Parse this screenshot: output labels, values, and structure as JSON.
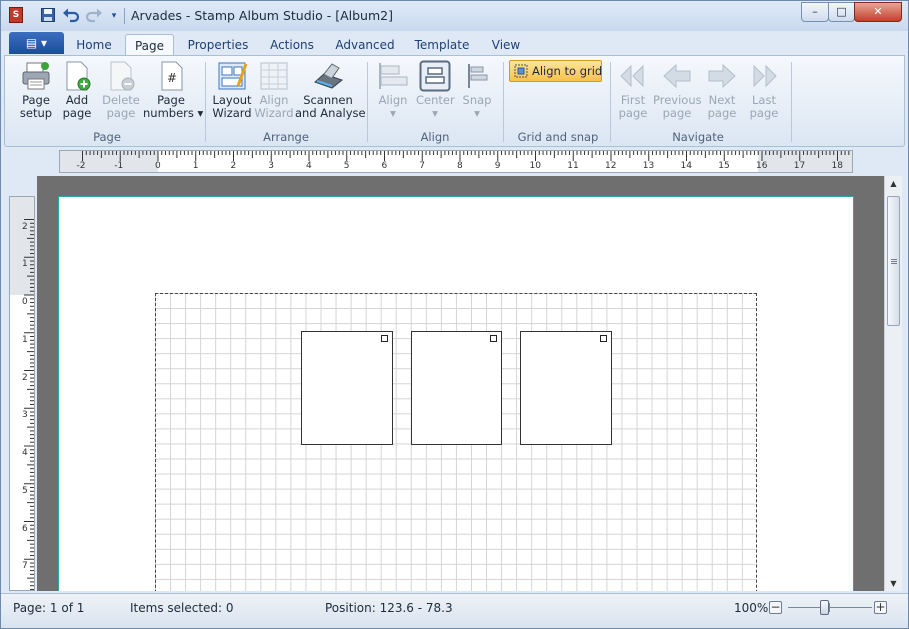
{
  "window": {
    "title": "Arvades - Stamp Album Studio - [Album2]",
    "app_icon_letter": "S",
    "controls": {
      "minimize": "–",
      "maximize": "□",
      "close": "✕"
    }
  },
  "quick_access": {
    "save_icon": "save-icon",
    "undo_icon": "undo-icon",
    "redo_icon": "redo-icon",
    "customize_icon": "chevron-down-icon"
  },
  "ribbon_tabs": {
    "file_tab": "▤ ▾",
    "tabs": [
      "Home",
      "Page",
      "Properties",
      "Actions",
      "Advanced",
      "Template",
      "View"
    ],
    "active": "Page"
  },
  "ribbon": {
    "groups": {
      "page": {
        "label": "Page",
        "buttons": [
          {
            "label": "Page\nsetup",
            "icon": "printer-icon",
            "enabled": true
          },
          {
            "label": "Add\npage",
            "icon": "add-page-icon",
            "enabled": true
          },
          {
            "label": "Delete\npage",
            "icon": "delete-page-icon",
            "enabled": false
          },
          {
            "label": "Page\nnumbers ▾",
            "icon": "page-numbers-icon",
            "enabled": true
          }
        ]
      },
      "arrange": {
        "label": "Arrange",
        "buttons": [
          {
            "label": "Layout\nWizard",
            "icon": "layout-wizard-icon",
            "enabled": true
          },
          {
            "label": "Align\nWizard",
            "icon": "align-wizard-icon",
            "enabled": false
          },
          {
            "label": "Scannen\nand Analyse",
            "icon": "scanner-icon",
            "enabled": true
          }
        ]
      },
      "align": {
        "label": "Align",
        "buttons": [
          {
            "label": "Align\n▾",
            "icon": "align-icon",
            "enabled": false
          },
          {
            "label": "Center\n▾",
            "icon": "center-icon",
            "enabled": false
          },
          {
            "label": "Snap\n▾",
            "icon": "snap-icon",
            "enabled": false
          }
        ]
      },
      "grid_and_snap": {
        "label": "Grid and snap",
        "align_to_grid": "Align to grid"
      },
      "navigate": {
        "label": "Navigate",
        "buttons": [
          {
            "label": "First\npage",
            "icon": "first-page-icon",
            "enabled": false
          },
          {
            "label": "Previous\npage",
            "icon": "previous-page-icon",
            "enabled": false
          },
          {
            "label": "Next\npage",
            "icon": "next-page-icon",
            "enabled": false
          },
          {
            "label": "Last\npage",
            "icon": "last-page-icon",
            "enabled": false
          }
        ]
      }
    }
  },
  "rulers": {
    "horizontal_labels": [
      "-2",
      "-1",
      "0",
      "1",
      "2",
      "3",
      "4",
      "5",
      "6",
      "7",
      "8",
      "9",
      "10",
      "11",
      "12",
      "13",
      "14",
      "15",
      "16",
      "17",
      "18"
    ],
    "vertical_labels": [
      "2",
      "1",
      "0",
      "1",
      "2",
      "3",
      "4",
      "5",
      "6",
      "7"
    ]
  },
  "canvas": {
    "stamp_count": 3
  },
  "status": {
    "page": "Page: 1 of 1",
    "items_selected": "Items selected: 0",
    "position": "Position: 123.6 - 78.3",
    "zoom": "100%",
    "zoom_minus": "−",
    "zoom_plus": "+"
  },
  "colors": {
    "page_border": "#2aa9a2",
    "highlight_button": "#f7c24a",
    "file_tab": "#1c4d9c"
  }
}
